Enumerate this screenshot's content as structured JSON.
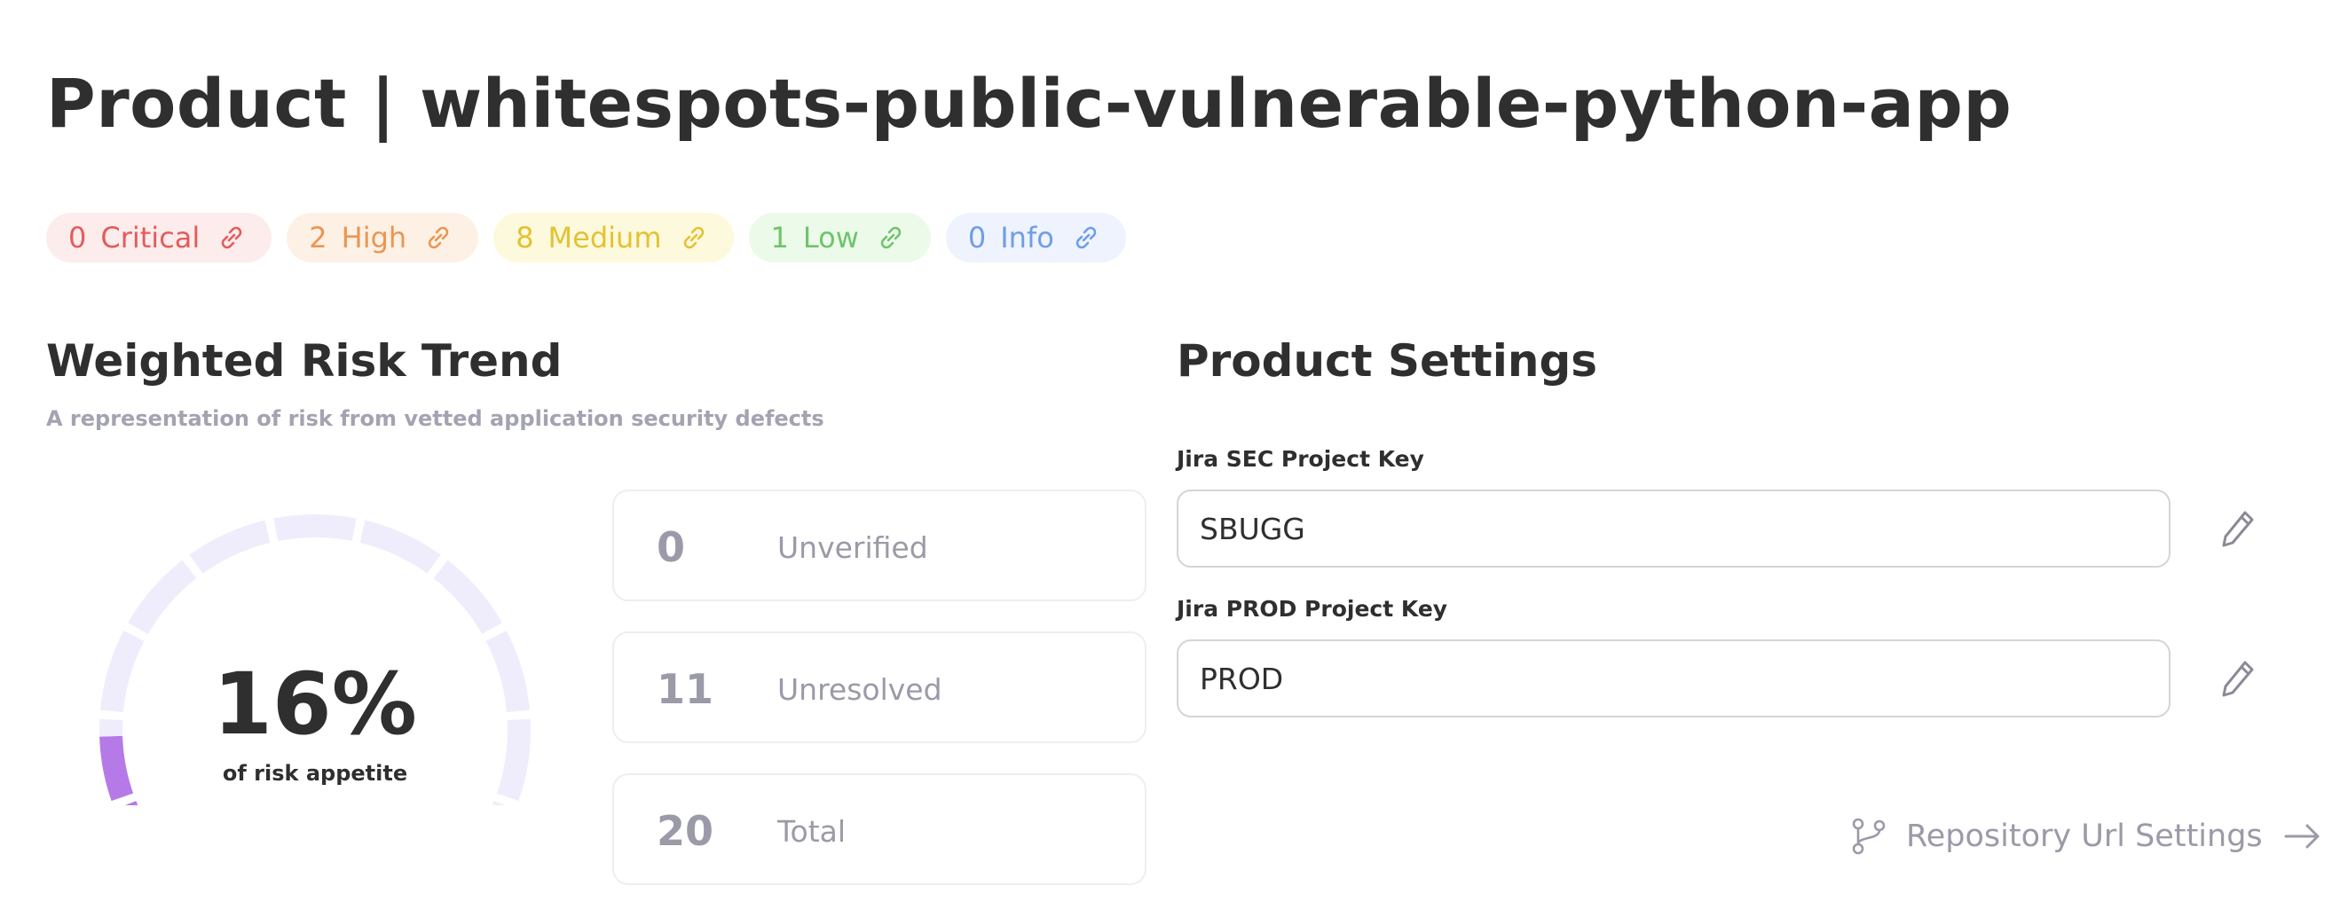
{
  "header": {
    "title": "Product | whitespots-public-vulnerable-python-app"
  },
  "severity_badges": [
    {
      "count": "0",
      "label": "Critical",
      "color": "#e25c5c",
      "bg": "#fdecec"
    },
    {
      "count": "2",
      "label": "High",
      "color": "#ec9552",
      "bg": "#fdf1e5"
    },
    {
      "count": "8",
      "label": "Medium",
      "color": "#e3c234",
      "bg": "#fdf9dc"
    },
    {
      "count": "1",
      "label": "Low",
      "color": "#6fc46c",
      "bg": "#ecfaea"
    },
    {
      "count": "0",
      "label": "Info",
      "color": "#6f9de8",
      "bg": "#eef3fd"
    }
  ],
  "risk_trend": {
    "title": "Weighted Risk Trend",
    "subtitle": "A representation of risk from vetted application security defects",
    "gauge": {
      "value_text": "16%",
      "value": 16,
      "caption": "of risk appetite",
      "fill_color": "#b57ae8",
      "track_color": "#efedfb"
    },
    "stats": [
      {
        "count": "0",
        "label": "Unverified"
      },
      {
        "count": "11",
        "label": "Unresolved"
      },
      {
        "count": "20",
        "label": "Total"
      }
    ]
  },
  "settings": {
    "title": "Product Settings",
    "fields": [
      {
        "label": "Jira SEC Project Key",
        "value": "SBUGG"
      },
      {
        "label": "Jira PROD Project Key",
        "value": "PROD"
      }
    ],
    "repo_link_label": "Repository Url Settings"
  }
}
